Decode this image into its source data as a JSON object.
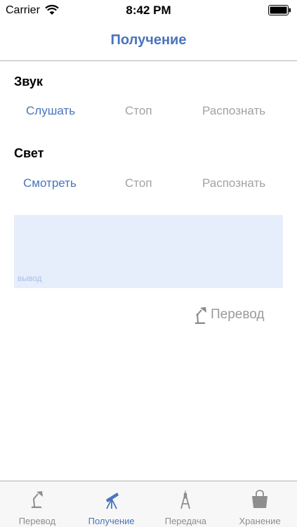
{
  "status_bar": {
    "carrier": "Carrier",
    "time": "8:42 PM",
    "icons": [
      "wifi-icon",
      "battery-icon"
    ]
  },
  "nav": {
    "title": "Получение"
  },
  "sound": {
    "title": "Звук",
    "buttons": [
      {
        "label": "Слушать",
        "active": true
      },
      {
        "label": "Стоп",
        "active": false
      },
      {
        "label": "Распознать",
        "active": false
      }
    ]
  },
  "light": {
    "title": "Свет",
    "buttons": [
      {
        "label": "Смотреть",
        "active": true
      },
      {
        "label": "Стоп",
        "active": false
      },
      {
        "label": "Распознать",
        "active": false
      }
    ]
  },
  "output": {
    "placeholder": "вывод",
    "value": ""
  },
  "translate": {
    "label": "Перевод",
    "icon": "desk-lamp-icon"
  },
  "tab_bar": {
    "selected": "Получение",
    "tabs": [
      {
        "label": "Перевод",
        "icon": "desk-lamp-icon"
      },
      {
        "label": "Получение",
        "icon": "telescope-icon"
      },
      {
        "label": "Передача",
        "icon": "eiffel-tower-icon"
      },
      {
        "label": "Хранение",
        "icon": "bag-icon"
      }
    ]
  },
  "colors": {
    "accent": "#4a74bd",
    "inactive": "#a2a2a2",
    "output_bg": "#e6eefb"
  }
}
